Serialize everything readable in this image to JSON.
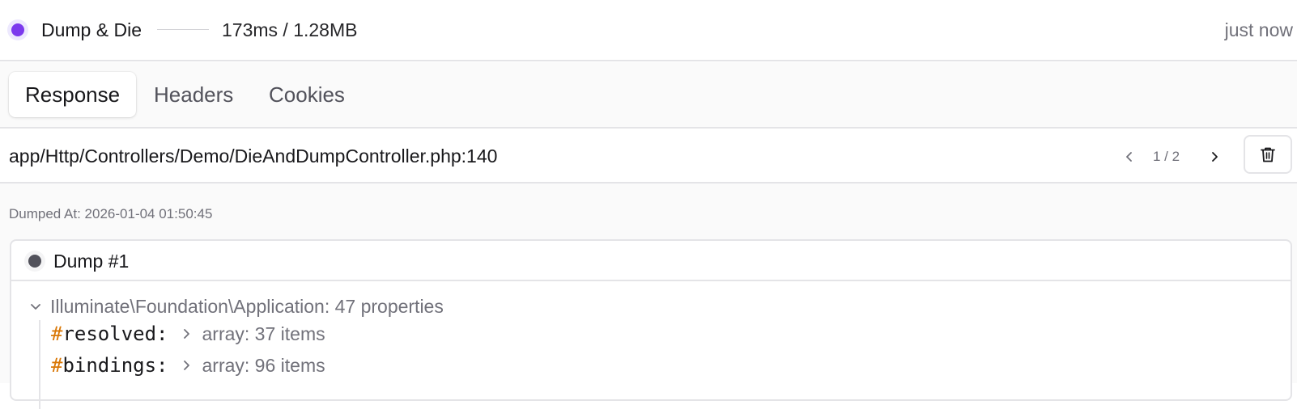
{
  "header": {
    "title": "Dump & Die",
    "metrics": "173ms / 1.28MB",
    "time_ago": "just now",
    "status_color": "#7c3aed"
  },
  "tabs": [
    {
      "label": "Response",
      "active": true
    },
    {
      "label": "Headers",
      "active": false
    },
    {
      "label": "Cookies",
      "active": false
    }
  ],
  "location": {
    "file_path": "app/Http/Controllers/Demo/DieAndDumpController.php:140",
    "page": "1 / 2",
    "prev_icon": "chevron-left-icon",
    "next_icon": "chevron-right-icon",
    "delete_icon": "trash-icon"
  },
  "dump": {
    "dumped_at": "Dumped At: 2026-01-04 01:50:45",
    "title": "Dump #1",
    "root_label": "Illuminate\\Foundation\\Application: 47 properties",
    "properties": [
      {
        "hash": "#",
        "name": "resolved:",
        "value": "array: 37 items"
      },
      {
        "hash": "#",
        "name": "bindings:",
        "value": "array: 96 items"
      }
    ]
  }
}
